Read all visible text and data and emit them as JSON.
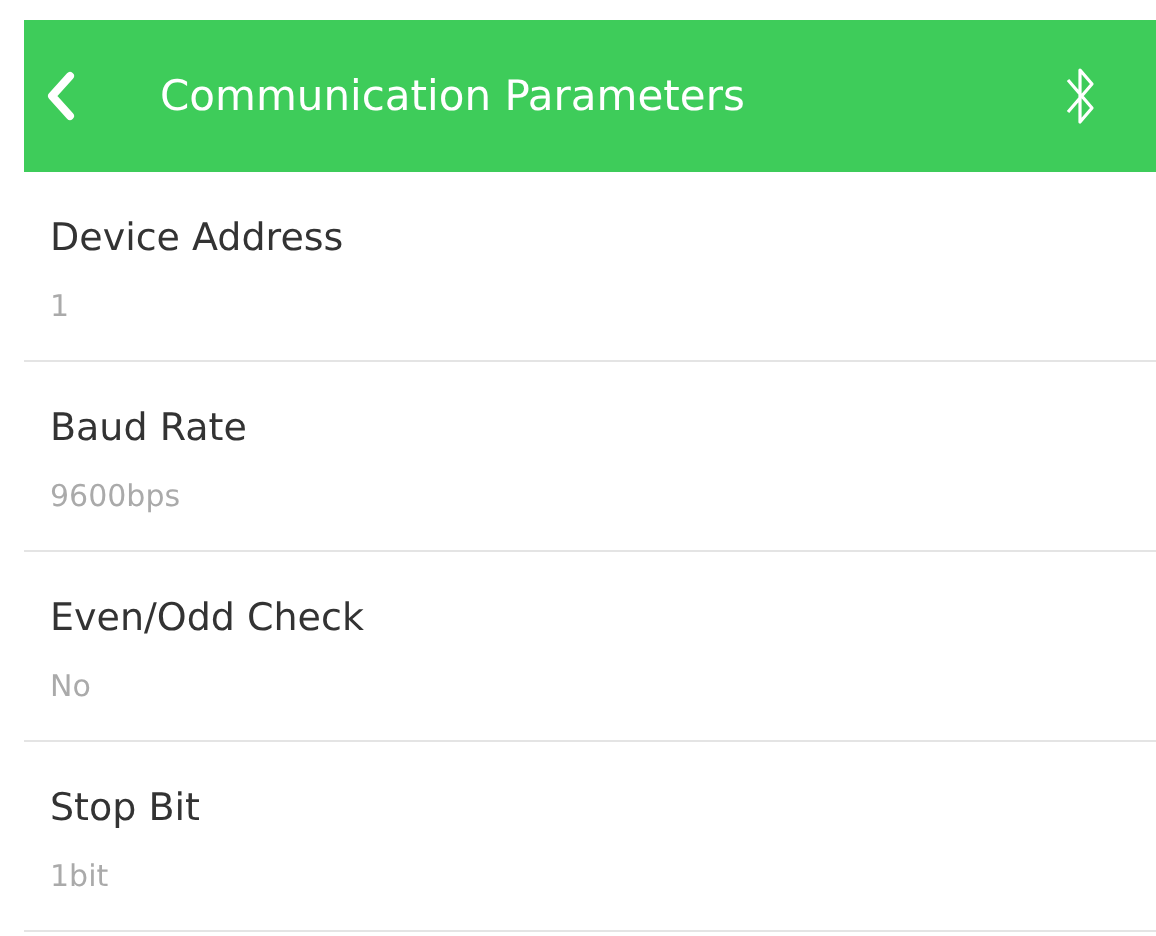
{
  "header": {
    "title": "Communication Parameters"
  },
  "settings": [
    {
      "label": "Device Address",
      "value": "1"
    },
    {
      "label": "Baud Rate",
      "value": "9600bps"
    },
    {
      "label": "Even/Odd Check",
      "value": "No"
    },
    {
      "label": "Stop Bit",
      "value": "1bit"
    }
  ]
}
